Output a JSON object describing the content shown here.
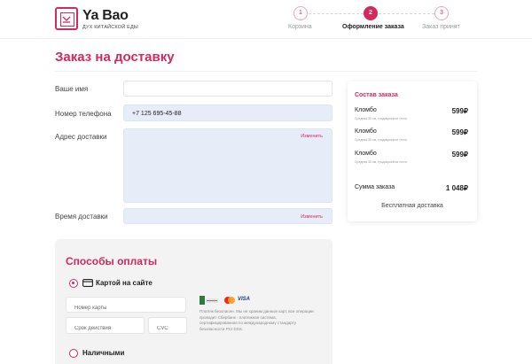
{
  "brand": {
    "name": "Ya Bao",
    "tagline": "ДУХ КИТАЙСКОЙ ЕДЫ",
    "color": "#d3295e"
  },
  "steps": [
    {
      "number": "1",
      "label": "Корзина",
      "state": "done"
    },
    {
      "number": "2",
      "label": "Оформление заказа",
      "state": "active"
    },
    {
      "number": "3",
      "label": "Заказ принят",
      "state": "pending"
    }
  ],
  "page_title": "Заказ на доставку",
  "form": {
    "name_label": "Ваше имя",
    "name_value": "",
    "phone_label": "Номер телефона",
    "phone_value": "+7 125 695-45-88",
    "address_label": "Адрес доставки",
    "address_edit": "Изменить",
    "time_label": "Время доставки",
    "time_edit": "Изменить"
  },
  "payment": {
    "title": "Способы оплаты",
    "card_option": "Картой на сайте",
    "card_number_placeholder": "Номер карты",
    "expiry_placeholder": "Срок действия",
    "cvc_placeholder": "CVC",
    "cash_option": "Наличными",
    "secure_note": "Платеж безопасен. Мы не храним данные карт, все операции проводит Сбербанк - платежная система, сертифицированная по международному стандарту безопасности PCI DSS.",
    "logos": [
      "pci-dss-logo",
      "mastercard-logo",
      "visa-logo"
    ],
    "visa_text": "VISA"
  },
  "summary": {
    "title": "Состав заказа",
    "items": [
      {
        "name": "Кломбо",
        "description": "Средняя 30 см, традиционное тесто",
        "price": "599₽"
      },
      {
        "name": "Кломбо",
        "description": "Средняя 30 см, традиционное тесто",
        "price": "599₽"
      },
      {
        "name": "Кломбо",
        "description": "Средняя 30 см, традиционное тесто",
        "price": "599₽"
      }
    ],
    "total_label": "Сумма заказа",
    "total_value": "1 048₽",
    "delivery_note": "Бесплатная доставка"
  }
}
